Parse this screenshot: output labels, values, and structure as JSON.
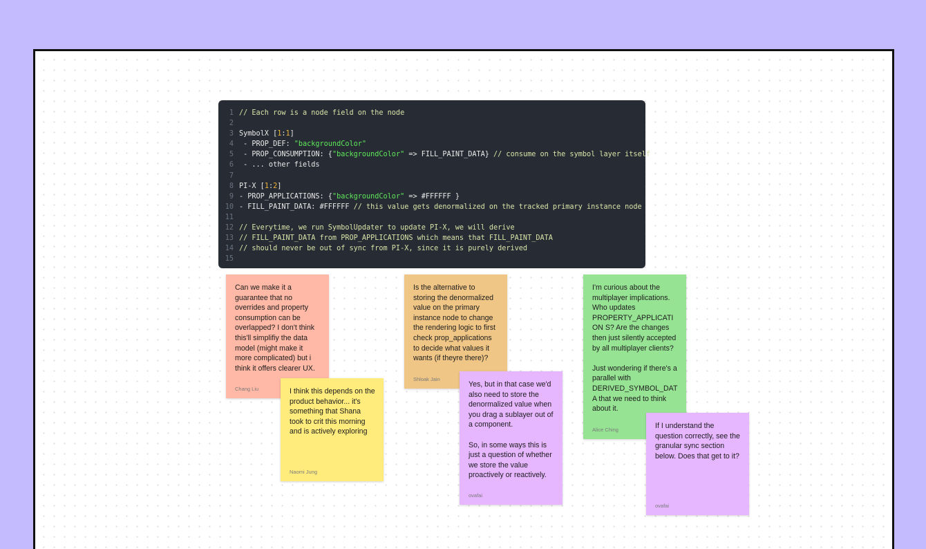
{
  "colors": {
    "background": "#c4bafe",
    "board": "#ffffff",
    "code_bg": "#272c34",
    "sticky_salmon": "#ffb9a6",
    "sticky_orange": "#f0c686",
    "sticky_green": "#97e394",
    "sticky_yellow": "#ffec7d",
    "sticky_violet": "#e6b6ff"
  },
  "code_block": {
    "lines": [
      {
        "n": "1",
        "tokens": [
          {
            "t": "// Each row is a node field on the node",
            "c": "comment"
          }
        ]
      },
      {
        "n": "2",
        "tokens": []
      },
      {
        "n": "3",
        "tokens": [
          {
            "t": "SymbolX [",
            "c": "plain"
          },
          {
            "t": "1",
            "c": "num"
          },
          {
            "t": ":",
            "c": "plain"
          },
          {
            "t": "1",
            "c": "num"
          },
          {
            "t": "]",
            "c": "plain"
          }
        ]
      },
      {
        "n": "4",
        "tokens": [
          {
            "t": " - PROP_DEF: ",
            "c": "plain"
          },
          {
            "t": "\"backgroundColor\"",
            "c": "string"
          }
        ]
      },
      {
        "n": "5",
        "tokens": [
          {
            "t": " - PROP_CONSUMPTION: {",
            "c": "plain"
          },
          {
            "t": "\"backgroundColor\"",
            "c": "string"
          },
          {
            "t": " => FILL_PAINT_DATA} ",
            "c": "plain"
          },
          {
            "t": "// consume on the symbol layer itself",
            "c": "comment"
          }
        ]
      },
      {
        "n": "6",
        "tokens": [
          {
            "t": " - ... other fields",
            "c": "plain"
          }
        ]
      },
      {
        "n": "7",
        "tokens": []
      },
      {
        "n": "8",
        "tokens": [
          {
            "t": "PI-X [",
            "c": "plain"
          },
          {
            "t": "1",
            "c": "num"
          },
          {
            "t": ":",
            "c": "plain"
          },
          {
            "t": "2",
            "c": "num"
          },
          {
            "t": "]",
            "c": "plain"
          }
        ]
      },
      {
        "n": "9",
        "tokens": [
          {
            "t": "- PROP_APPLICATIONS: {",
            "c": "plain"
          },
          {
            "t": "\"backgroundColor\"",
            "c": "string"
          },
          {
            "t": " => #FFFFFF }",
            "c": "plain"
          }
        ]
      },
      {
        "n": "10",
        "tokens": [
          {
            "t": "- FILL_PAINT_DATA: #FFFFFF ",
            "c": "plain"
          },
          {
            "t": "// this value gets denormalized on the tracked primary instance node",
            "c": "comment"
          }
        ]
      },
      {
        "n": "11",
        "tokens": []
      },
      {
        "n": "12",
        "tokens": [
          {
            "t": "// Everytime, we run SymbolUpdater to update PI-X, we will derive",
            "c": "comment"
          }
        ]
      },
      {
        "n": "13",
        "tokens": [
          {
            "t": "// FILL_PAINT_DATA from PROP_APPLICATIONS which means that FILL_PAINT_DATA",
            "c": "comment"
          }
        ]
      },
      {
        "n": "14",
        "tokens": [
          {
            "t": "// should never be out of sync from PI-X, since it is purely derived",
            "c": "comment"
          }
        ]
      },
      {
        "n": "15",
        "tokens": []
      }
    ]
  },
  "stickies": [
    {
      "text": "Can we make it a guarantee that no overrides and property consumption can be overlapped? I don't think this'll simplifiy the data model (might make it more complicated) but i think it offers clearer UX.",
      "author": "Chang Liu",
      "color": "#ffb9a6"
    },
    {
      "text": "I think this depends on the product behavior... it's something that Shana took to crit this morning and is actively exploring",
      "author": "Naomi Jung",
      "color": "#ffec7d"
    },
    {
      "text": "Is the alternative to storing the denormalized value on the primary instance node to change the rendering logic to first check prop_applications to decide what values it wants (if theyre there)?",
      "author": "Shloak Jain",
      "color": "#f0c686"
    },
    {
      "text": "Yes, but in that case we'd also need to store the denormalized value when you drag a sublayer out of a component.\n\nSo, in some ways this is just a question of whether we store the value proactively or reactively.",
      "author": "ovafai",
      "color": "#e6b6ff"
    },
    {
      "text": "I'm curious about the multiplayer implications. Who updates PROPERTY_APPLICATION S? Are the changes then just silently accepted by all multiplayer clients?\n\nJust wondering if there's a parallel with DERIVED_SYMBOL_DATA that we need to think about it.",
      "author": "Alice Ching",
      "color": "#97e394"
    },
    {
      "text": "If I understand the question correctly, see the granular sync section below. Does that get to it?",
      "author": "ovafai",
      "color": "#e6b6ff"
    }
  ]
}
